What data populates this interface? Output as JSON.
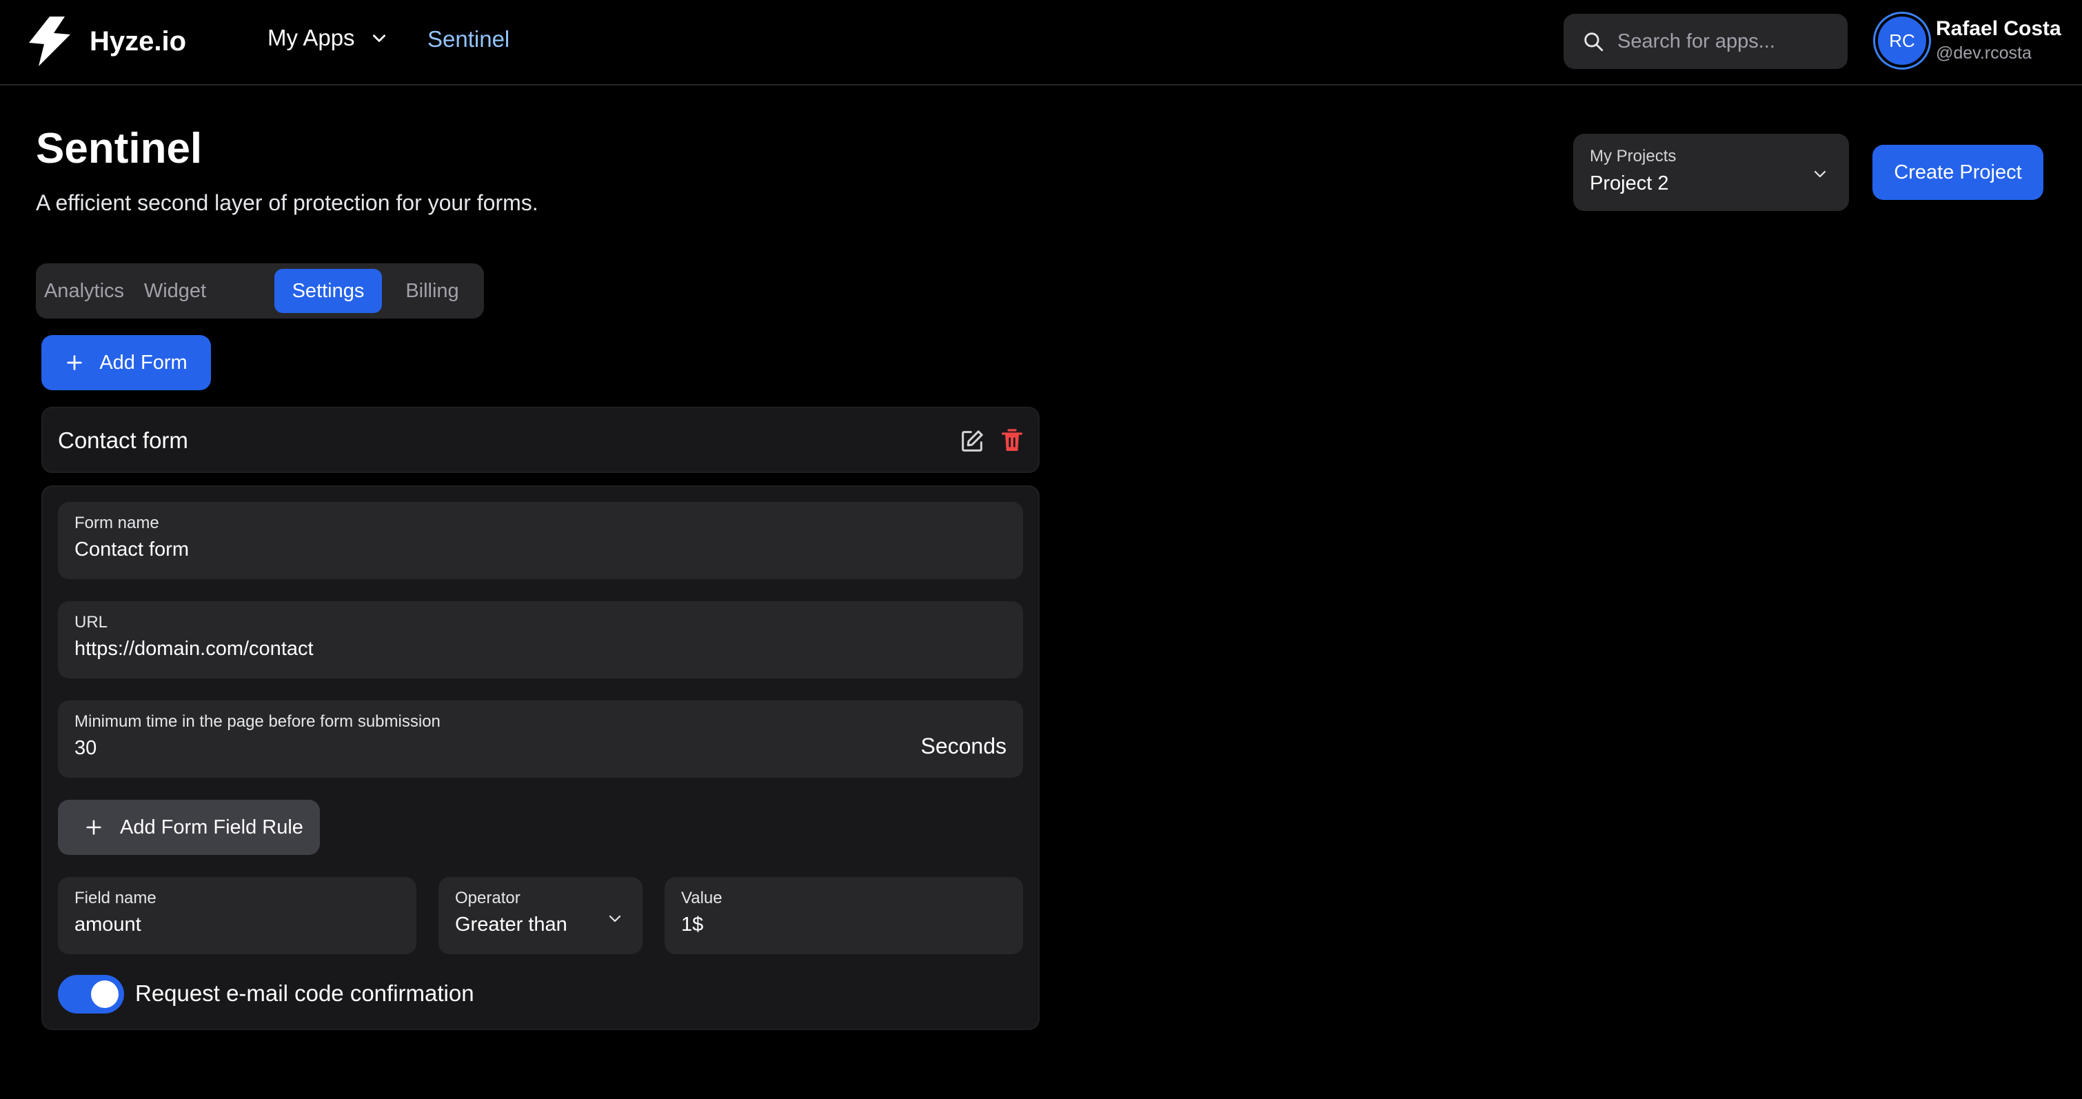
{
  "brand": {
    "name": "Hyze.io",
    "icon": "lightning-bolt-icon"
  },
  "nav": {
    "apps_label": "My Apps",
    "current_app": "Sentinel"
  },
  "search": {
    "placeholder": "Search for apps..."
  },
  "user": {
    "initials": "RC",
    "name": "Rafael Costa",
    "handle": "@dev.rcosta"
  },
  "page": {
    "title": "Sentinel",
    "subtitle": "A efficient second layer of protection for your forms."
  },
  "project_select": {
    "label": "My Projects",
    "value": "Project 2"
  },
  "actions": {
    "create_project": "Create Project",
    "add_form": "Add Form"
  },
  "tabs": [
    {
      "label": "Analytics",
      "active": false
    },
    {
      "label": "Widget",
      "active": false
    },
    {
      "label": "Settings",
      "active": true
    },
    {
      "label": "Billing",
      "active": false
    }
  ],
  "form": {
    "title": "Contact form",
    "fields": {
      "name": {
        "label": "Form name",
        "value": "Contact form"
      },
      "url": {
        "label": "URL",
        "value": "https://domain.com/contact"
      },
      "min_time": {
        "label": "Minimum time in the page before form submission",
        "value": "30",
        "suffix": "Seconds"
      }
    },
    "add_rule_label": "Add Form Field Rule",
    "rule": {
      "field_name": {
        "label": "Field name",
        "value": "amount"
      },
      "operator": {
        "label": "Operator",
        "value": "Greater than"
      },
      "value": {
        "label": "Value",
        "value": "1$"
      }
    },
    "email_confirmation": {
      "label": "Request e-mail code confirmation",
      "enabled": true
    }
  },
  "colors": {
    "accent": "#2563eb",
    "accent_text": "#93c5fd",
    "danger": "#ef4444",
    "surface": "#27272a",
    "card": "#18181b"
  }
}
